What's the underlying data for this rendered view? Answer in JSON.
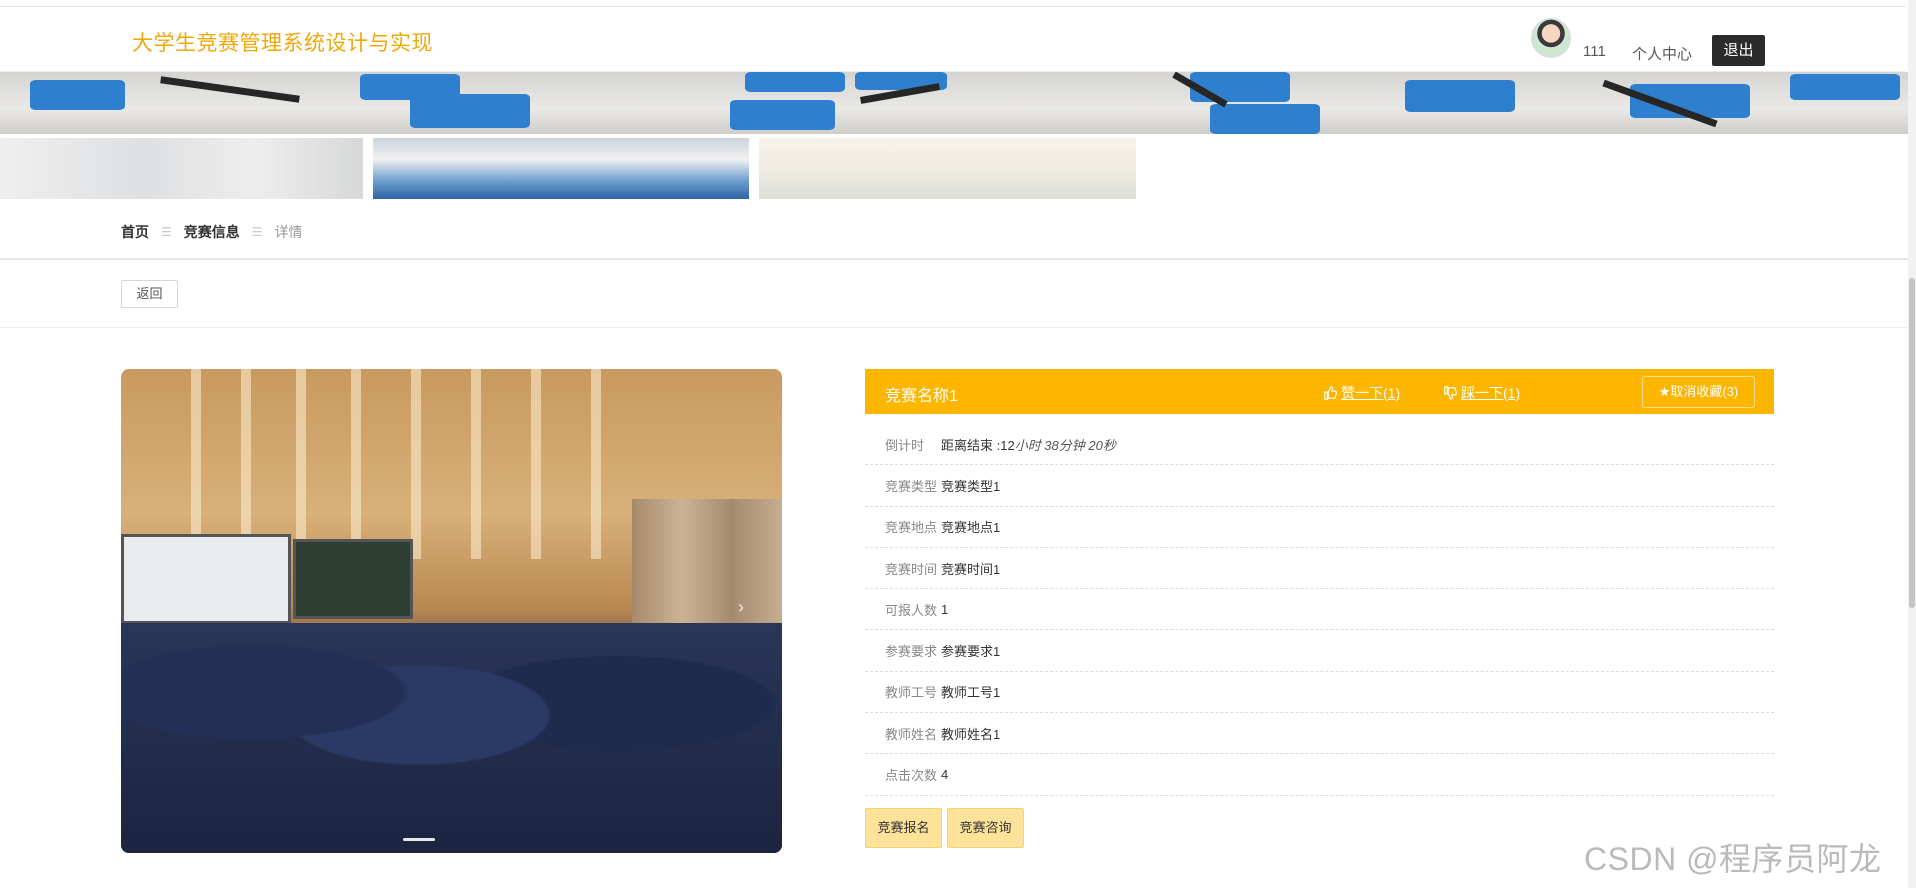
{
  "header": {
    "brand": "大学生竞赛管理系统设计与实现",
    "username": "111",
    "user_center": "个人中心",
    "logout": "退出",
    "avatar_icon": "user-avatar"
  },
  "breadcrumb": {
    "home": "首页",
    "section": "竞赛信息",
    "current": "详情",
    "separator": "☰"
  },
  "back_button": "返回",
  "detail": {
    "title": "竞赛名称1",
    "like_label": "赞一下(1)",
    "dislike_label": "踩一下(1)",
    "favorite_label": "★取消收藏(3)",
    "accent_color": "#fdb600",
    "countdown": {
      "label": "倒计时",
      "prefix": "距离结束 :12",
      "rest": "小时 38分钟 20秒"
    },
    "fields": [
      {
        "label": "竞赛类型",
        "value": "竞赛类型1"
      },
      {
        "label": "竞赛地点",
        "value": "竞赛地点1"
      },
      {
        "label": "竞赛时间",
        "value": "竞赛时间1"
      },
      {
        "label": "可报人数",
        "value": "1"
      },
      {
        "label": "参赛要求",
        "value": "参赛要求1"
      },
      {
        "label": "教师工号",
        "value": "教师工号1"
      },
      {
        "label": "教师姓名",
        "value": "教师姓名1"
      },
      {
        "label": "点击次数",
        "value": "4"
      }
    ],
    "signup_button": "竞赛报名",
    "consult_button": "竞赛咨询"
  },
  "watermark": "CSDN @程序员阿龙"
}
